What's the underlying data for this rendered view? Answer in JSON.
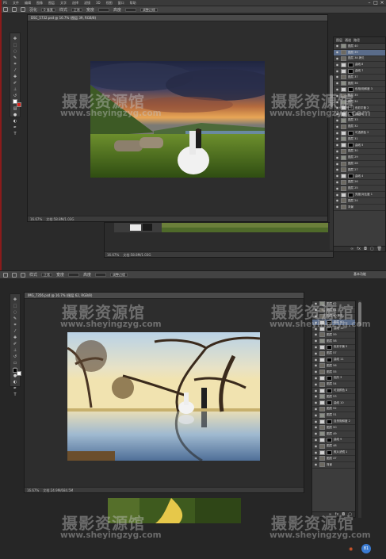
{
  "screenshot1": {
    "menubar": [
      "PS",
      "文件",
      "编辑",
      "图像",
      "图层",
      "文字",
      "选择",
      "滤镜",
      "3D",
      "视图",
      "窗口",
      "帮助"
    ],
    "options": [
      "调整边缘",
      "样式",
      "正常",
      "宽度",
      "高度"
    ],
    "feather_label": "羽化",
    "feather_value": "0 像素",
    "doc_title": "DSC_5732.psd @ 16.7% (图层 39, RGB/8)",
    "status_zoom": "16.67%",
    "status_info": "文档:58.8M/1.03G",
    "status2_zoom": "16.67%",
    "status2_info": "文档:58.8M/1.03G",
    "layers_tabs": [
      "图层",
      "通道",
      "路径"
    ],
    "layers": [
      {
        "name": "图层 40",
        "mask": false
      },
      {
        "name": "图层 39",
        "mask": false
      },
      {
        "name": "图层 38 拷贝",
        "mask": false
      },
      {
        "name": "曲线 8",
        "mask": true
      },
      {
        "name": "曲线 7",
        "mask": true
      },
      {
        "name": "图层 37",
        "mask": false
      },
      {
        "name": "图层 36",
        "mask": false
      },
      {
        "name": "色相/饱和度 3",
        "mask": true
      },
      {
        "name": "图层 35",
        "mask": false
      },
      {
        "name": "图层 34",
        "mask": false
      },
      {
        "name": "色彩平衡 2",
        "mask": true
      },
      {
        "name": "曲线 6",
        "mask": true
      },
      {
        "name": "图层 33",
        "mask": false
      },
      {
        "name": "图层 32",
        "mask": false
      },
      {
        "name": "可选颜色 2",
        "mask": true
      },
      {
        "name": "图层 31",
        "mask": false
      },
      {
        "name": "曲线 5",
        "mask": true
      },
      {
        "name": "图层 30",
        "mask": false
      },
      {
        "name": "图层 29",
        "mask": false
      },
      {
        "name": "图层 28",
        "mask": false
      },
      {
        "name": "图层 27",
        "mask": false
      },
      {
        "name": "曲线 4",
        "mask": true
      },
      {
        "name": "图层 26",
        "mask": false
      },
      {
        "name": "图层 25",
        "mask": false
      },
      {
        "name": "亮度/对比度 1",
        "mask": true
      },
      {
        "name": "图层 24",
        "mask": false
      },
      {
        "name": "背景",
        "mask": false
      }
    ],
    "selected_layer_index": 1
  },
  "screenshot2": {
    "options": [
      "调整边缘",
      "样式",
      "正常",
      "宽度",
      "高度"
    ],
    "doc_title": "IMG_7356.psd @ 16.7% (图层 62, RGB/8)",
    "status_zoom": "16.67%",
    "status_info": "文档:24.9M/684.5M",
    "right_label": "基本功能",
    "layers": [
      {
        "name": "图层 62",
        "mask": false
      },
      {
        "name": "图层 61",
        "mask": false
      },
      {
        "name": "图层 60 拷贝",
        "mask": false
      },
      {
        "name": "图层 60",
        "mask": true
      },
      {
        "name": "曲线 12",
        "mask": true
      },
      {
        "name": "图层 59",
        "mask": false
      },
      {
        "name": "图层 58",
        "mask": false
      },
      {
        "name": "色彩平衡 5",
        "mask": true
      },
      {
        "name": "图层 57",
        "mask": false
      },
      {
        "name": "曲线 11",
        "mask": true
      },
      {
        "name": "图层 56",
        "mask": false
      },
      {
        "name": "图层 55",
        "mask": false
      },
      {
        "name": "色阶 3",
        "mask": true
      },
      {
        "name": "图层 54",
        "mask": false
      },
      {
        "name": "可选颜色 4",
        "mask": true
      },
      {
        "name": "图层 53",
        "mask": false
      },
      {
        "name": "曲线 10",
        "mask": true
      },
      {
        "name": "图层 52",
        "mask": false
      },
      {
        "name": "图层 51",
        "mask": false
      },
      {
        "name": "自然饱和度 2",
        "mask": true
      },
      {
        "name": "图层 50",
        "mask": false
      },
      {
        "name": "图层 49",
        "mask": false
      },
      {
        "name": "曲线 9",
        "mask": true
      },
      {
        "name": "图层 48",
        "mask": false
      },
      {
        "name": "照片滤镜 1",
        "mask": true
      },
      {
        "name": "图层 47",
        "mask": false
      },
      {
        "name": "背景",
        "mask": false
      }
    ],
    "selected_layer_index": 3
  },
  "watermark": {
    "cn": "摄影资源馆",
    "url": "www.sheyingzyg.com"
  },
  "corner_badge": "81"
}
